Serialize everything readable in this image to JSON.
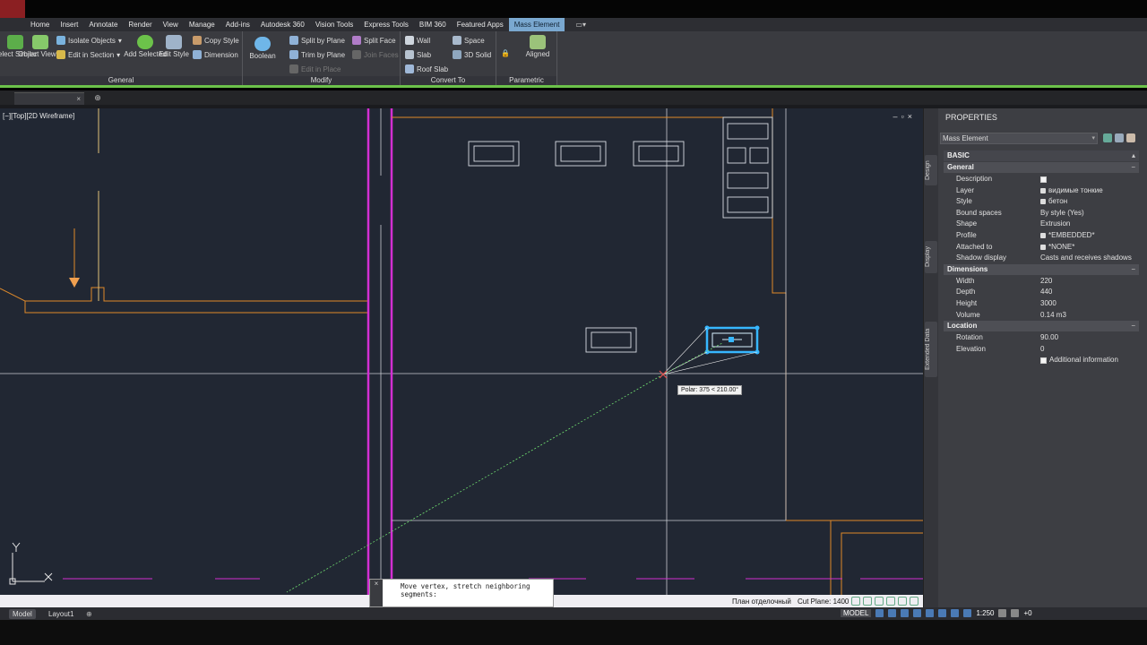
{
  "ribbon": {
    "tabs": [
      "Home",
      "Insert",
      "Annotate",
      "Render",
      "View",
      "Manage",
      "Add-ins",
      "Autodesk 360",
      "Vision Tools",
      "Express Tools",
      "BIM 360",
      "Featured Apps",
      "Mass Element"
    ],
    "active_tab": "Mass Element",
    "panels": {
      "general": {
        "label": "General",
        "select_similar": "Select Similar",
        "object_viewer": "Object Viewer",
        "isolate_objects": "Isolate Objects",
        "edit_in_section": "Edit in Section",
        "add_selected": "Add Selected",
        "edit_style": "Edit Style",
        "copy_style": "Copy Style",
        "dimension": "Dimension"
      },
      "modify": {
        "label": "Modify",
        "boolean": "Boolean",
        "split_by_plane": "Split by Plane",
        "split_face": "Split Face",
        "trim_by_plane": "Trim by Plane",
        "join_faces": "Join Faces",
        "edit_in_place": "Edit in Place"
      },
      "convert_to": {
        "label": "Convert To",
        "wall": "Wall",
        "space": "Space",
        "slab": "Slab",
        "solid_3d": "3D Solid",
        "roof_slab": "Roof Slab"
      },
      "parametric": {
        "label": "Parametric",
        "aligned": "Aligned"
      }
    }
  },
  "viewport": {
    "label": "[−][Top][2D Wireframe]",
    "polar_tooltip": "Polar: 375 < 210.00°"
  },
  "command_line": {
    "prompt": "Move vertex, stretch neighboring segments:"
  },
  "status_bar": {
    "plan_label": "План отделочный",
    "cut_plane": "Cut Plane: 1400",
    "model_label": "MODEL",
    "scale": "1:250",
    "plus_zero": "+0"
  },
  "layout_tabs": [
    "Model",
    "Layout1"
  ],
  "properties": {
    "title": "PROPERTIES",
    "object_type": "Mass Element",
    "side_tabs": [
      "Design",
      "Display",
      "Extended Data"
    ],
    "section_basic": "BASIC",
    "section_general": "General",
    "general": [
      {
        "key": "Description",
        "value": ""
      },
      {
        "key": "Layer",
        "value": "видимые тонкие"
      },
      {
        "key": "Style",
        "value": "бетон"
      },
      {
        "key": "Bound spaces",
        "value": "By style (Yes)"
      },
      {
        "key": "Shape",
        "value": "Extrusion"
      },
      {
        "key": "Profile",
        "value": "*EMBEDDED*"
      },
      {
        "key": "Attached to",
        "value": "*NONE*"
      },
      {
        "key": "Shadow display",
        "value": "Casts and receives shadows"
      }
    ],
    "section_dimensions": "Dimensions",
    "dimensions": [
      {
        "key": "Width",
        "value": "220"
      },
      {
        "key": "Depth",
        "value": "440"
      },
      {
        "key": "Height",
        "value": "3000"
      },
      {
        "key": "Volume",
        "value": "0.14 m3"
      }
    ],
    "section_location": "Location",
    "location": [
      {
        "key": "Rotation",
        "value": "90.00"
      },
      {
        "key": "Elevation",
        "value": "0"
      }
    ],
    "additional_information": "Additional information"
  },
  "colors": {
    "drawing_bg": "#212733",
    "magenta": "#d22fd2",
    "orange": "#e08a2a",
    "selection": "#37b7ff",
    "ribbon_accent": "#6cc24a"
  }
}
